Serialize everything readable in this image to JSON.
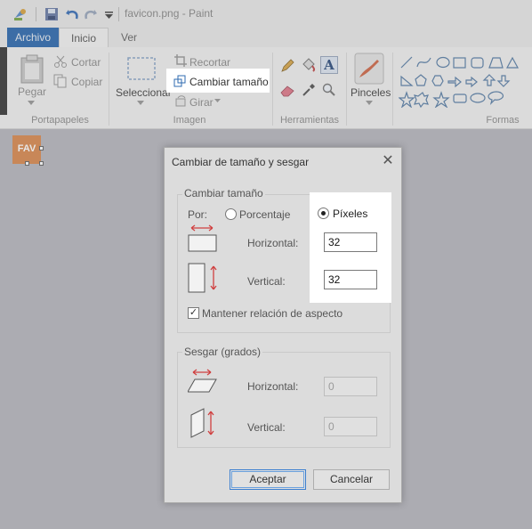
{
  "window": {
    "title": "favicon.png - Paint"
  },
  "tabs": [
    {
      "label": "Archivo"
    },
    {
      "label": "Inicio"
    },
    {
      "label": "Ver"
    }
  ],
  "ribbon": {
    "clipboard": {
      "paste_label": "Pegar",
      "cut_label": "Cortar",
      "copy_label": "Copiar",
      "group_label": "Portapapeles"
    },
    "image": {
      "select_label": "Seleccionar",
      "crop_label": "Recortar",
      "resize_label": "Cambiar tamaño",
      "rotate_label": "Girar",
      "group_label": "Imagen"
    },
    "tools": {
      "group_label": "Herramientas"
    },
    "brushes": {
      "label": "Pinceles"
    },
    "shapes": {
      "group_label": "Formas"
    }
  },
  "canvas": {
    "image_text": "FAV",
    "image_color": "#d98a51"
  },
  "dialog": {
    "title": "Cambiar de tamaño y sesgar",
    "resize_section": {
      "legend": "Cambiar tamaño",
      "by_label": "Por:",
      "percent_label": "Porcentaje",
      "pixels_label": "Píxeles",
      "selected": "Píxeles",
      "horizontal_label": "Horizontal:",
      "horizontal_value": "32",
      "vertical_label": "Vertical:",
      "vertical_value": "32",
      "keep_aspect_label": "Mantener relación de aspecto",
      "keep_aspect_checked": true
    },
    "skew_section": {
      "legend": "Sesgar (grados)",
      "horizontal_label": "Horizontal:",
      "horizontal_value": "0",
      "vertical_label": "Vertical:",
      "vertical_value": "0"
    },
    "ok_label": "Aceptar",
    "cancel_label": "Cancelar"
  },
  "colors": {
    "accent": "#2f6bb0",
    "arrow_red": "#d04040"
  }
}
